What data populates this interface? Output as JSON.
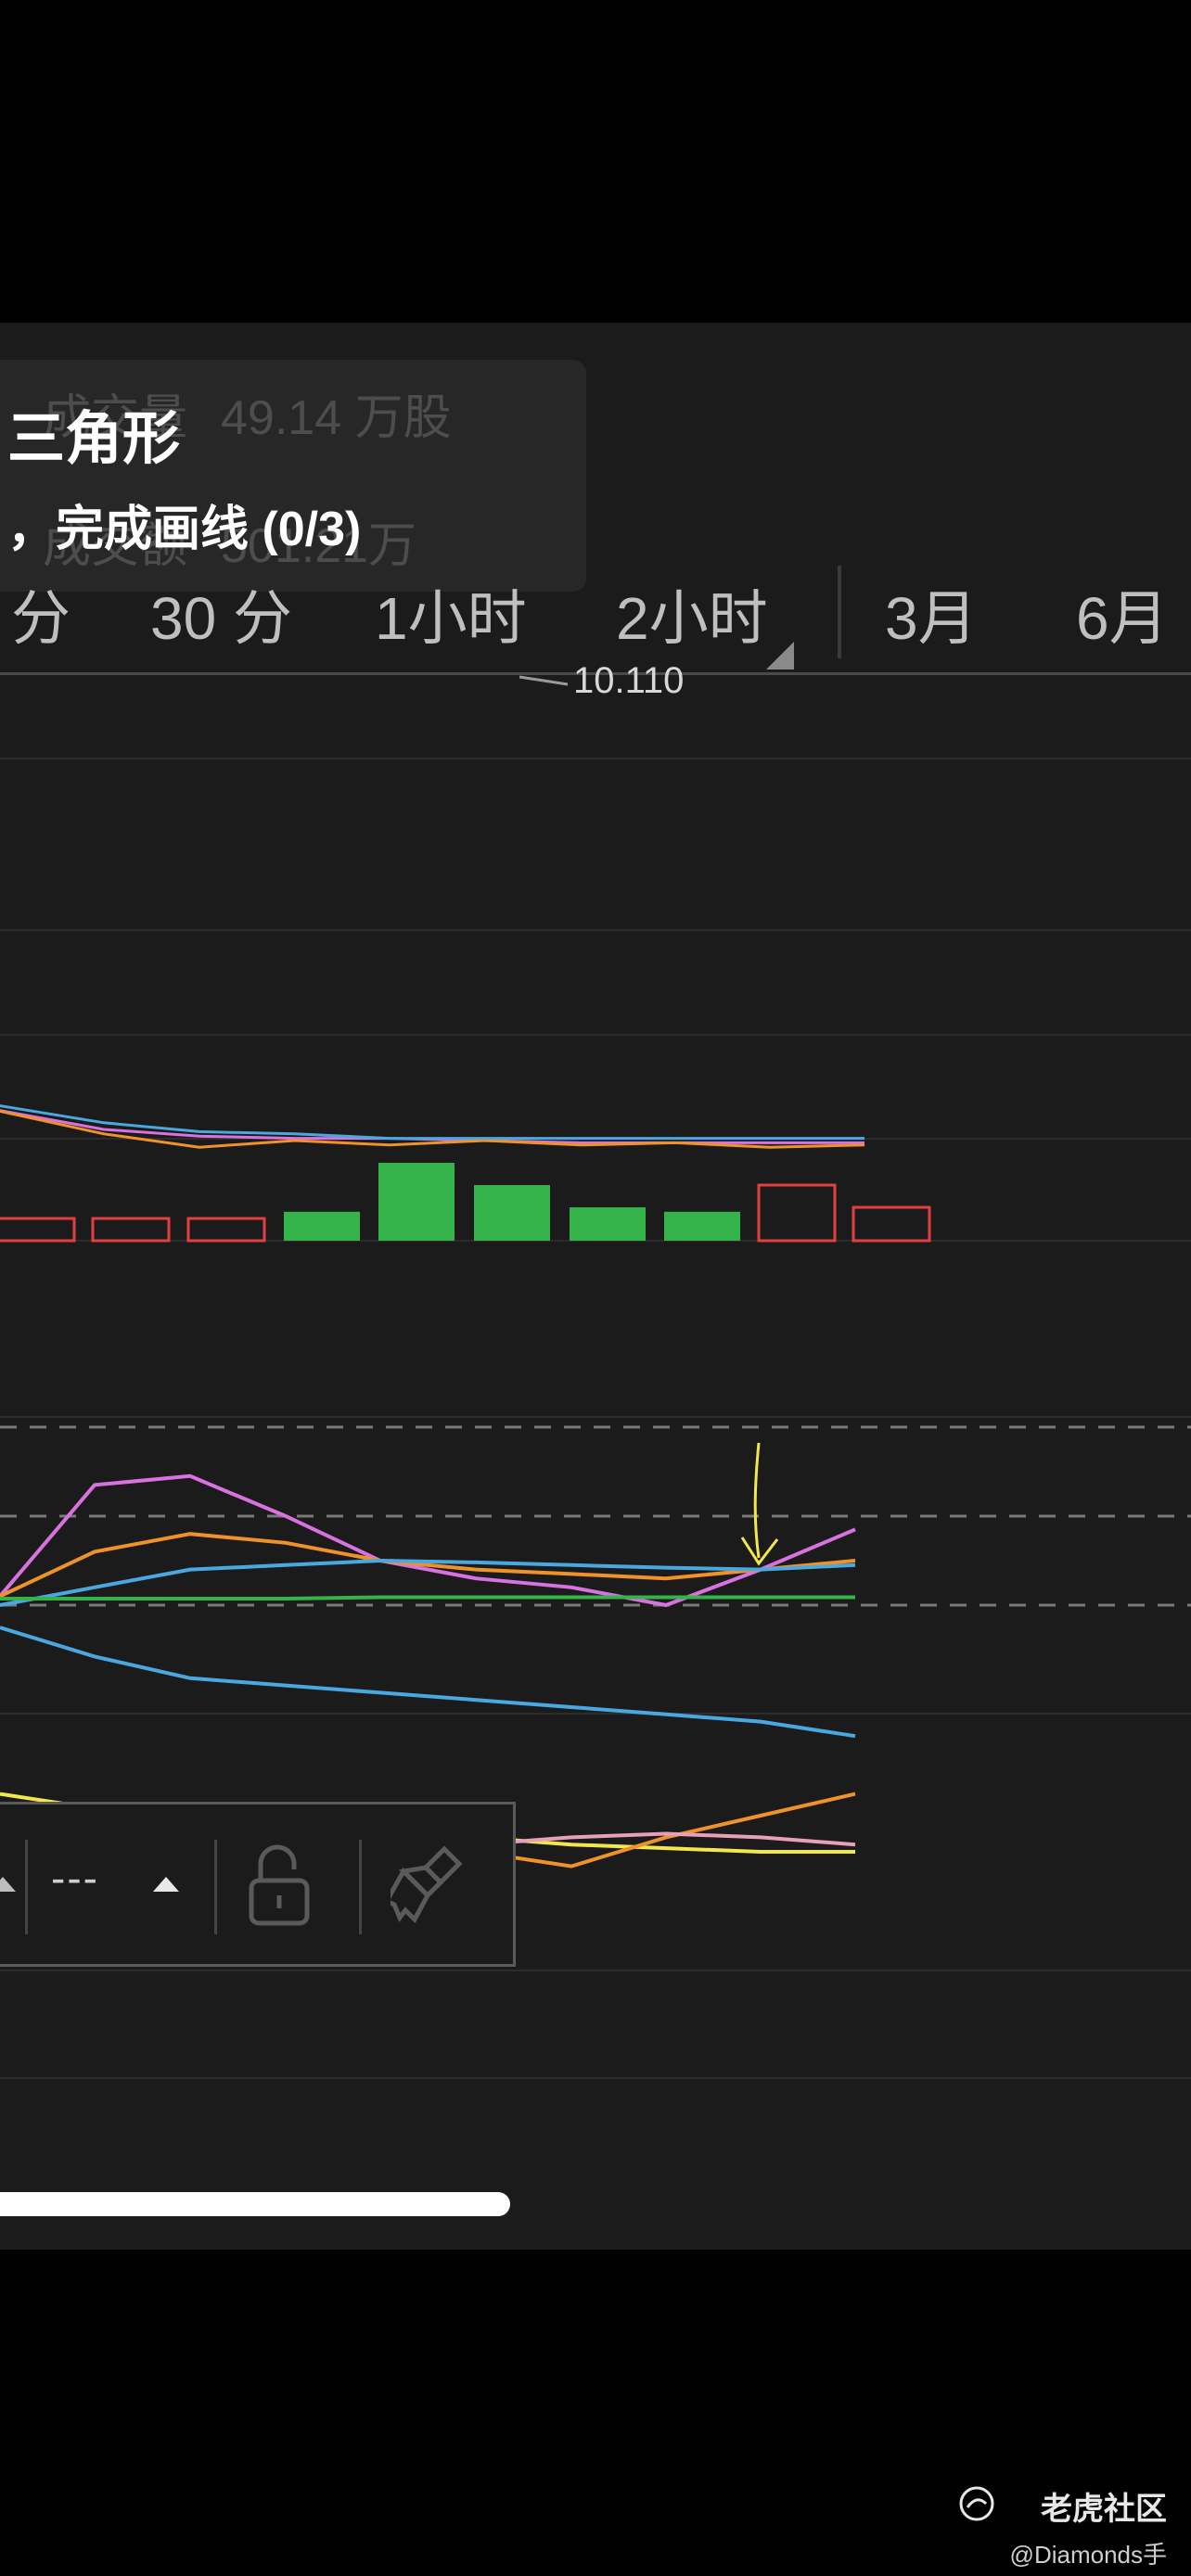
{
  "tooltip": {
    "volume_label": "成交量",
    "volume_value": "49.14 万股",
    "amount_label": "成交额",
    "amount_value": "501.21万",
    "drawing_title": "三角形",
    "drawing_hint": "，完成画线 (0/3)"
  },
  "tabs": [
    {
      "label": "分"
    },
    {
      "label": "30 分"
    },
    {
      "label": "1小时"
    },
    {
      "label": "2小时"
    },
    {
      "label": "3月"
    },
    {
      "label": "6月"
    }
  ],
  "price_label": "10.110",
  "toolbar": {
    "line_style": "---",
    "icons": [
      "chevron-up-icon",
      "lock-open-icon",
      "brush-icon"
    ]
  },
  "watermark": {
    "site": "老虎社区",
    "user": "@Diamonds手"
  },
  "colors": {
    "background": "#1b1b1b",
    "green": "#34b34a",
    "red": "#e04040",
    "magenta": "#d872e0",
    "orange": "#f0922a",
    "blue": "#4aa8e0",
    "yellow": "#f2e84a",
    "pink": "#e8a0b8"
  },
  "chart_data": [
    {
      "type": "bar",
      "categories": [
        "1",
        "2",
        "3",
        "4",
        "5",
        "6",
        "7",
        "8",
        "9",
        "10"
      ],
      "values": [
        1,
        1,
        1,
        1.3,
        3.5,
        2.5,
        1.5,
        1.3,
        2.5,
        1.5
      ],
      "directions": [
        "down",
        "down",
        "down",
        "up",
        "up",
        "up",
        "up",
        "up",
        "down",
        "down"
      ],
      "series": [
        {
          "values": [
            6.0,
            5.0,
            4.7,
            4.6,
            4.6,
            4.5,
            4.4,
            4.4,
            4.4,
            4.4
          ]
        },
        {
          "values": [
            6.0,
            4.8,
            4.2,
            4.5,
            4.3,
            4.5,
            4.3,
            4.4,
            4.2,
            4.3
          ]
        },
        {
          "values": [
            6.2,
            5.3,
            4.9,
            4.8,
            4.6,
            4.6,
            4.6,
            4.6,
            4.6,
            4.6
          ]
        }
      ]
    },
    {
      "type": "line",
      "x": [
        0,
        1,
        2,
        3,
        4,
        5,
        6,
        7,
        8,
        9
      ],
      "reference_lines": [
        3,
        2,
        1
      ],
      "series": [
        {
          "values": [
            1.1,
            2.35,
            2.45,
            2.0,
            1.5,
            1.3,
            1.2,
            1.0,
            1.4,
            1.85
          ]
        },
        {
          "values": [
            1.1,
            1.6,
            1.8,
            1.7,
            1.5,
            1.4,
            1.35,
            1.3,
            1.4,
            1.5
          ]
        },
        {
          "values": [
            1.0,
            1.2,
            1.4,
            1.45,
            1.5,
            1.48,
            1.45,
            1.42,
            1.4,
            1.45
          ]
        }
      ],
      "annotation": "down-arrow"
    },
    {
      "type": "line",
      "x": [
        0,
        1,
        2,
        3,
        4,
        5,
        6,
        7,
        8,
        9
      ],
      "series": [
        {
          "values": [
            8.0,
            8.0,
            8.0,
            8.0,
            8.02,
            8.02,
            8.02,
            8.02,
            8.02,
            8.02
          ]
        },
        {
          "values": [
            7.6,
            7.2,
            6.9,
            6.8,
            6.7,
            6.6,
            6.5,
            6.4,
            6.3,
            6.1
          ]
        },
        {
          "values": [
            5.3,
            5.1,
            4.95,
            4.9,
            4.8,
            4.7,
            4.6,
            4.55,
            4.5,
            4.5
          ]
        },
        {
          "values": [
            4.9,
            5.0,
            4.85,
            5.0,
            4.8,
            4.5,
            4.3,
            4.7,
            5.0,
            5.3
          ]
        },
        {
          "values": [
            4.9,
            4.7,
            4.5,
            4.45,
            4.5,
            4.6,
            4.7,
            4.75,
            4.7,
            4.6
          ]
        }
      ]
    }
  ]
}
